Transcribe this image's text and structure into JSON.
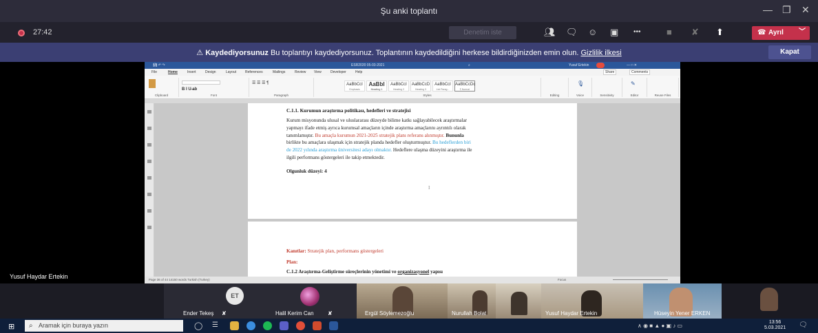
{
  "window": {
    "title": "Şu anki toplantı",
    "controls": {
      "minimize": "—",
      "maximize": "❐",
      "close": "✕"
    }
  },
  "meeting": {
    "timer": "27:42",
    "help_label": "Denetim iste",
    "leave_label": "Ayrıl",
    "leave_chevron": "﹀",
    "more_label": "•••",
    "colors": {
      "leave": "#c4314b",
      "banner": "#3b3f73",
      "bar": "#23222d"
    }
  },
  "banner": {
    "title": "Kaydediyorsunuz",
    "message": " Bu toplantıyı kaydediyorsunuz. Toplantının kaydedildiğini herkese bildirdiğinizden emin olun. ",
    "link": "Gizlilik ilkesi",
    "close_label": "Kapat"
  },
  "word": {
    "title": "ESR2020 05-03-2021",
    "user": "Yusuf Ertekin",
    "tabs": [
      "File",
      "Home",
      "Insert",
      "Design",
      "Layout",
      "References",
      "Mailings",
      "Review",
      "View",
      "Developer",
      "Help"
    ],
    "share_label": "Share",
    "comments_label": "Comments",
    "groups": [
      "Clipboard",
      "Font",
      "Paragraph",
      "Styles",
      "Editing",
      "Voice",
      "Sensitivity",
      "Editor",
      "Reuse Files"
    ],
    "styles": [
      {
        "sample": "AaBbCcI",
        "name": "Emphasis"
      },
      {
        "sample": "AaBbI",
        "name": "Heading 1"
      },
      {
        "sample": "AaBbCcI",
        "name": "Heading 2"
      },
      {
        "sample": "AaBbCcD",
        "name": "Heading 3"
      },
      {
        "sample": "AaBbCcI",
        "name": "List Parag..."
      },
      {
        "sample": "AaBbCcDc",
        "name": "¶ Normal"
      }
    ],
    "status_left": "Page 36 of 44   14150 words   Turkish (Turkey)",
    "status_right": "Focus"
  },
  "doc": {
    "heading1": "C.1.1. Kurumun araştırma politikası, hedefleri ve stratejisi",
    "p1_lines": [
      "Kurum misyonunda ulusal ve uluslararası düzeyde bilime katkı sağlayabilecek araştırmalar",
      "yapmayı ifade etmiş ayrıca kurumsal amaçların içinde araştırma amaçlarını ayrıntılı olarak"
    ],
    "p1_line3_a": "tanımlamıştır. ",
    "p1_line3_red": "Bu amaçla kurumun 2021-2025 stratejik planı referans alınmıştır.",
    "p1_line3_b": " Bununla",
    "p1_line4_a": "birlikte bu amaçlara ulaşmak için stratejik planda hedefler oluşturmuştur. ",
    "p1_line4_blue": "Bu hedeflerden biri",
    "p1_line5_blue": "de 2022 yılında araştırma üniversitesi adayı olmaktır.",
    "p1_line5_b": " Hedeflere ulaşma düzeyini araştırma ile",
    "p1_line6": "ilgili performans göstergeleri ile takip etmektedir.",
    "maturity": "Olgunluk düzeyi: 4",
    "evidence_label": "Kanıtlar:",
    "evidence_text": " Stratejik plan, performans göstergeleri",
    "plan_label": "Plan:",
    "heading2_a": "C.1.2 Araştırma-Geliştirme süreçlerinin yönetimi ve ",
    "heading2_u": "organizasyonel",
    "heading2_b": " yapısı"
  },
  "presenter": "Yusuf Haydar Ertekin",
  "participants": [
    {
      "name": "Ender Tekeş",
      "initials": "ET"
    },
    {
      "name": "Halil Kerim Can"
    },
    {
      "name": "Ergül Söylemezoğlu"
    },
    {
      "name": "Nurullah Bolat"
    },
    {
      "name": "Yusuf Haydar Ertekin"
    },
    {
      "name": "Hüseyin Yener ERKEN"
    }
  ],
  "taskbar": {
    "search_placeholder": "Aramak için buraya yazın",
    "time": "13:56",
    "date": "5.03.2021"
  }
}
